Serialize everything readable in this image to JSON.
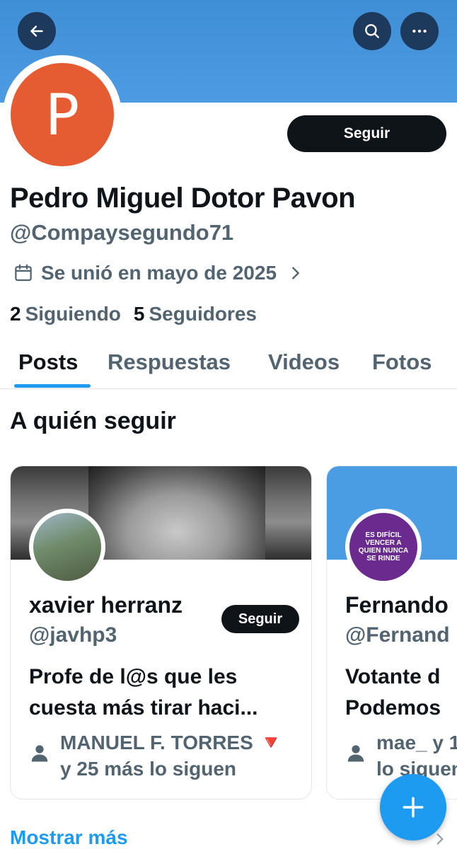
{
  "header": {
    "back_icon": "arrow-left-icon",
    "search_icon": "search-icon",
    "more_icon": "more-horizontal-icon",
    "banner_color": "#4a96dd"
  },
  "profile": {
    "avatar_letter": "P",
    "avatar_color": "#e55c32",
    "follow_label": "Seguir",
    "name": "Pedro Miguel Dotor Pavon",
    "handle": "@Compaysegundo71",
    "joined": "Se unió en mayo de 2025",
    "following_count": "2",
    "following_label": "Siguiendo",
    "followers_count": "5",
    "followers_label": "Seguidores"
  },
  "tabs": [
    {
      "label": "Posts",
      "active": true
    },
    {
      "label": "Respuestas",
      "active": false
    },
    {
      "label": "Videos",
      "active": false
    },
    {
      "label": "Fotos",
      "active": false
    }
  ],
  "who_to_follow": {
    "title": "A quién seguir",
    "cards": [
      {
        "name": "xavier herranz",
        "handle": "@javhp3",
        "follow_label": "Seguir",
        "bio_line1": "Profe de l@s que les",
        "bio_line2": "cuesta más tirar haci...",
        "followed_by_line1": "MANUEL F. TORRES 🔻",
        "followed_by_line2": "y 25 más lo siguen"
      },
      {
        "name": "Fernando",
        "handle": "@Fernand",
        "avatar_text": "ES DIFÍCIL VENCER A QUIEN NUNCA SE RINDE",
        "bio_line1": "Votante d",
        "bio_line2": "Podemos",
        "followed_by_line1": "mae_ y 1",
        "followed_by_line2": "lo siguen"
      }
    ],
    "show_more": "Mostrar más"
  },
  "fab": {
    "icon": "plus-icon",
    "color": "#1d9bf0"
  }
}
